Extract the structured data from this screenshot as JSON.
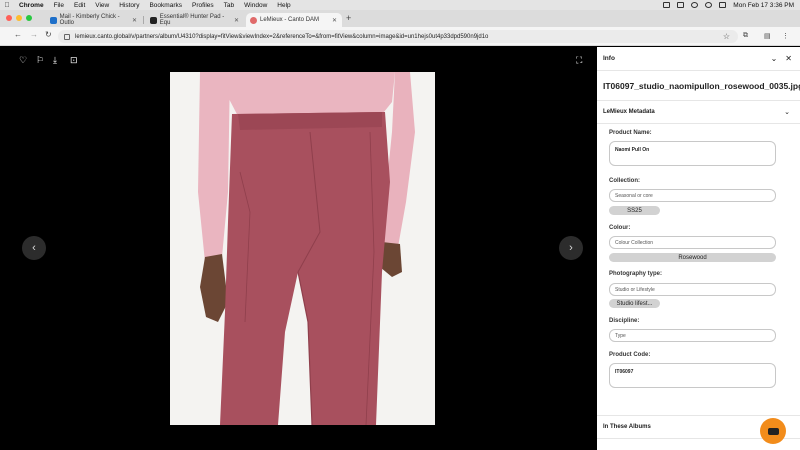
{
  "menubar": {
    "items": [
      "Chrome",
      "File",
      "Edit",
      "View",
      "History",
      "Bookmarks",
      "Profiles",
      "Tab",
      "Window",
      "Help"
    ],
    "datetime": "Mon Feb 17  3:36 PM"
  },
  "tabs": [
    {
      "label": "Mail - Kimberly Chick - Outlo",
      "color": "#1e6fc9"
    },
    {
      "label": "Essential® Hunter Pad - Equ",
      "color": "#222222"
    },
    {
      "label": "LeMieux - Canto DAM",
      "color": "#e06a6a"
    }
  ],
  "address": {
    "url": "lemieux.canto.global/v/partners/album/U4310?display=fitView&viewIndex=2&referenceTo=&from=fitView&column=image&id=un1hejs0ut4p33dpd590n9jd1o"
  },
  "panel": {
    "title": "Info",
    "filename": "IT06097_studio_naomipullon_rosewood_0035.jpg",
    "section_title": "LeMieux Metadata",
    "fields": {
      "product_name": {
        "label": "Product Name:",
        "value": "Naomi Pull On"
      },
      "collection": {
        "label": "Collection:",
        "placeholder": "Seasonal or core",
        "chip": "SS25"
      },
      "colour": {
        "label": "Colour:",
        "placeholder": "Colour Collection",
        "chip": "Rosewood"
      },
      "photography_type": {
        "label": "Photography type:",
        "placeholder": "Studio or Lifestyle",
        "chip": "Studio lifest..."
      },
      "discipline": {
        "label": "Discipline:",
        "placeholder": "Type"
      },
      "product_code": {
        "label": "Product Code:",
        "value": "IT06097"
      }
    },
    "albums_title": "In These Albums"
  },
  "colors": {
    "accent": "#f28c1b",
    "chip": "#d2d2d2",
    "legging": "#a8505e",
    "top": "#eab5c0"
  }
}
